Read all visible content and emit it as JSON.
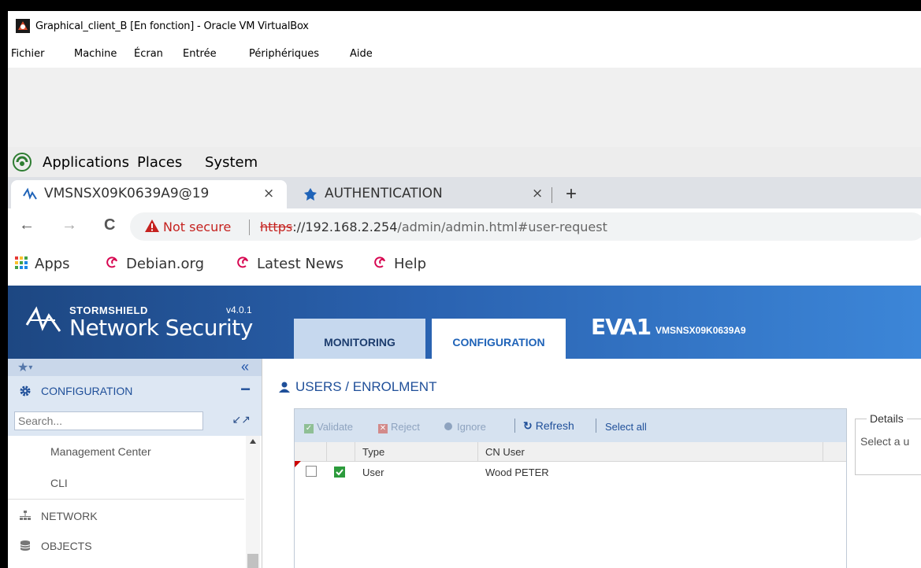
{
  "vbox": {
    "title": "Graphical_client_B [En fonction] - Oracle VM VirtualBox",
    "menu": [
      "Fichier",
      "Machine",
      "Écran",
      "Entrée",
      "Périphériques",
      "Aide"
    ]
  },
  "gnome_panel": {
    "items": [
      "Applications",
      "Places",
      "System"
    ]
  },
  "browser": {
    "tabs": [
      {
        "label": "VMSNSX09K0639A9@19",
        "close": "×"
      },
      {
        "label": "AUTHENTICATION",
        "close": "×"
      }
    ],
    "new_tab": "+",
    "nav": {
      "back": "←",
      "forward": "→",
      "reload": "C"
    },
    "security": "Not secure",
    "url_scheme": "https",
    "url_host": "://192.168.2.254",
    "url_path": "/admin/admin.html#user-request",
    "bookmarks": [
      "Apps",
      "Debian.org",
      "Latest News",
      "Help"
    ]
  },
  "app": {
    "brand_top": "STORMSHIELD",
    "brand": "Network Security",
    "version": "v4.0.1",
    "tabs": [
      "MONITORING",
      "CONFIGURATION"
    ],
    "device": "EVA1",
    "serial": "VMSNSX09K0639A9"
  },
  "sidebar": {
    "fav_star": "★",
    "fav_caret": "▾",
    "collapse": "«",
    "section": "CONFIGURATION",
    "section_toggle": "−",
    "search_placeholder": "Search...",
    "items": [
      {
        "label": "Management Center"
      },
      {
        "label": "CLI"
      },
      {
        "label": "NETWORK"
      },
      {
        "label": "OBJECTS"
      }
    ]
  },
  "main": {
    "title": "USERS / ENROLMENT",
    "toolbar": {
      "validate": "Validate",
      "reject": "Reject",
      "ignore": "Ignore",
      "refresh": "Refresh",
      "select_all": "Select all"
    },
    "columns": [
      "Type",
      "CN User"
    ],
    "rows": [
      {
        "type": "User",
        "cn_user": "Wood PETER"
      }
    ],
    "details_legend": "Details",
    "details_text": "Select a u"
  },
  "colors": {
    "header_start": "#1d4782",
    "header_end": "#3c86d8",
    "accent": "#1f4f99",
    "status_green": "#2c9b3c"
  },
  "icons": [
    "virtualbox-icon",
    "gnome-foot-icon",
    "stormshield-tab-icon",
    "authentication-tab-icon",
    "warning-icon",
    "apps-grid-icon",
    "debian-icon",
    "stormshield-logo-icon",
    "gear-icon",
    "user-icon",
    "network-icon",
    "objects-icon"
  ]
}
